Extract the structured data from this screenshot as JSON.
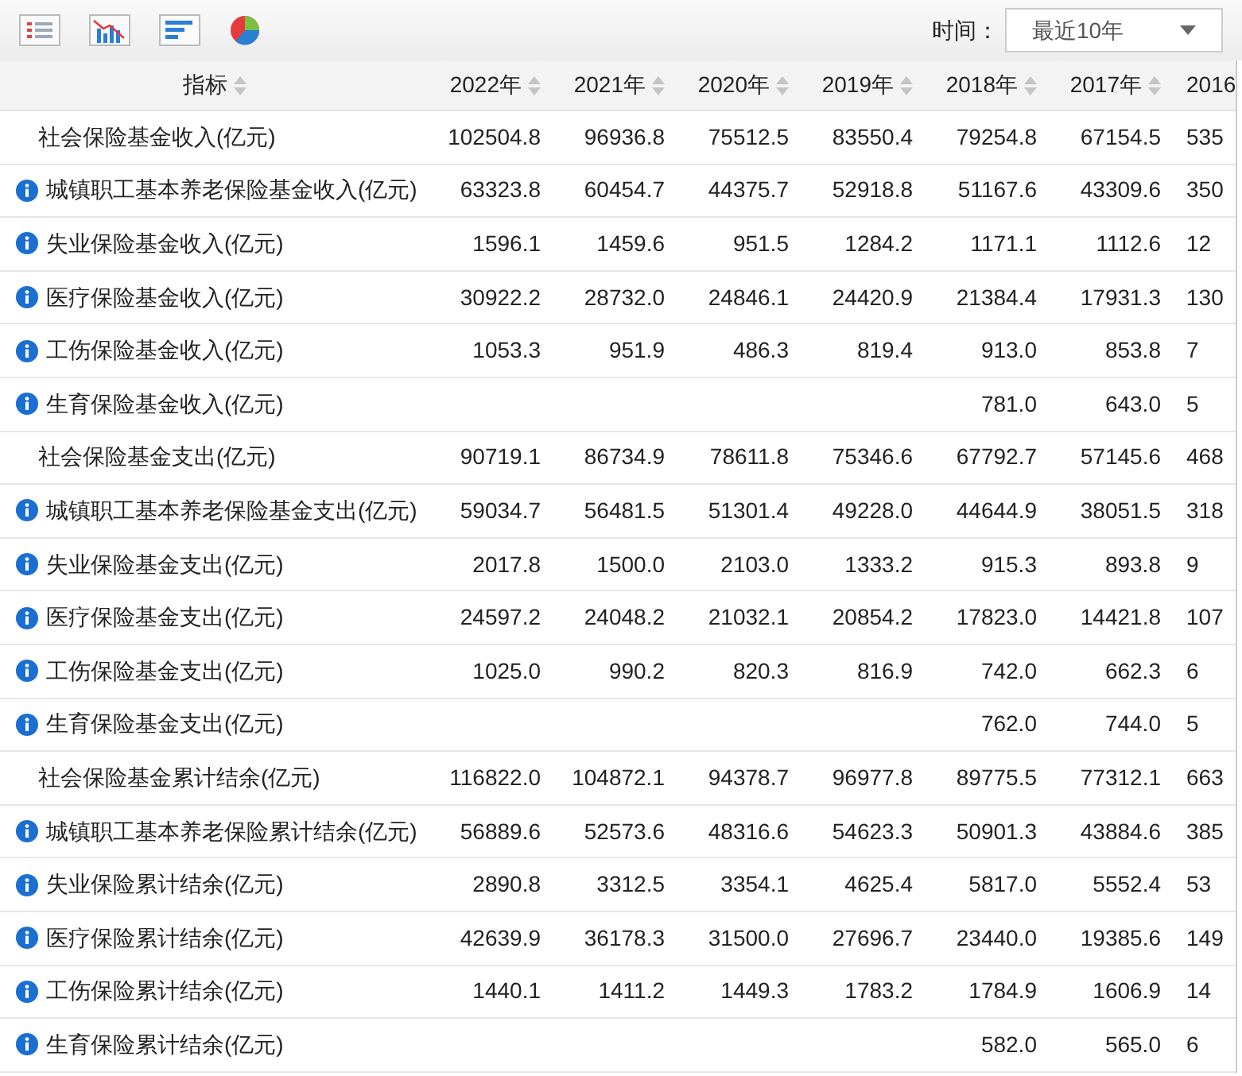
{
  "toolbar": {
    "time_label": "时间：",
    "time_select": {
      "value": "最近10年"
    }
  },
  "table": {
    "columns": [
      {
        "label": "指标",
        "sortable": true
      },
      {
        "label": "2022年",
        "sortable": true
      },
      {
        "label": "2021年",
        "sortable": true
      },
      {
        "label": "2020年",
        "sortable": true
      },
      {
        "label": "2019年",
        "sortable": true
      },
      {
        "label": "2018年",
        "sortable": true
      },
      {
        "label": "2017年",
        "sortable": true
      },
      {
        "label": "2016"
      }
    ],
    "rows": [
      {
        "kind": "total",
        "label": "社会保险基金收入(亿元)",
        "values": {
          "col_1": "102504.8",
          "col_2": "96936.8",
          "col_3": "75512.5",
          "col_4": "83550.4",
          "col_5": "79254.8",
          "col_6": "67154.5",
          "col_7": "535"
        }
      },
      {
        "kind": "item",
        "label": "城镇职工基本养老保险基金收入(亿元)",
        "values": {
          "col_1": "63323.8",
          "col_2": "60454.7",
          "col_3": "44375.7",
          "col_4": "52918.8",
          "col_5": "51167.6",
          "col_6": "43309.6",
          "col_7": "350"
        }
      },
      {
        "kind": "item",
        "label": "失业保险基金收入(亿元)",
        "values": {
          "col_1": "1596.1",
          "col_2": "1459.6",
          "col_3": "951.5",
          "col_4": "1284.2",
          "col_5": "1171.1",
          "col_6": "1112.6",
          "col_7": "12"
        }
      },
      {
        "kind": "item",
        "label": "医疗保险基金收入(亿元)",
        "values": {
          "col_1": "30922.2",
          "col_2": "28732.0",
          "col_3": "24846.1",
          "col_4": "24420.9",
          "col_5": "21384.4",
          "col_6": "17931.3",
          "col_7": "130"
        }
      },
      {
        "kind": "item",
        "label": "工伤保险基金收入(亿元)",
        "values": {
          "col_1": "1053.3",
          "col_2": "951.9",
          "col_3": "486.3",
          "col_4": "819.4",
          "col_5": "913.0",
          "col_6": "853.8",
          "col_7": "7"
        }
      },
      {
        "kind": "item",
        "label": "生育保险基金收入(亿元)",
        "values": {
          "col_5": "781.0",
          "col_6": "643.0",
          "col_7": "5"
        }
      },
      {
        "kind": "total",
        "label": "社会保险基金支出(亿元)",
        "values": {
          "col_1": "90719.1",
          "col_2": "86734.9",
          "col_3": "78611.8",
          "col_4": "75346.6",
          "col_5": "67792.7",
          "col_6": "57145.6",
          "col_7": "468"
        }
      },
      {
        "kind": "item",
        "label": "城镇职工基本养老保险基金支出(亿元)",
        "values": {
          "col_1": "59034.7",
          "col_2": "56481.5",
          "col_3": "51301.4",
          "col_4": "49228.0",
          "col_5": "44644.9",
          "col_6": "38051.5",
          "col_7": "318"
        }
      },
      {
        "kind": "item",
        "label": "失业保险基金支出(亿元)",
        "values": {
          "col_1": "2017.8",
          "col_2": "1500.0",
          "col_3": "2103.0",
          "col_4": "1333.2",
          "col_5": "915.3",
          "col_6": "893.8",
          "col_7": "9"
        }
      },
      {
        "kind": "item",
        "label": "医疗保险基金支出(亿元)",
        "values": {
          "col_1": "24597.2",
          "col_2": "24048.2",
          "col_3": "21032.1",
          "col_4": "20854.2",
          "col_5": "17823.0",
          "col_6": "14421.8",
          "col_7": "107"
        }
      },
      {
        "kind": "item",
        "label": "工伤保险基金支出(亿元)",
        "values": {
          "col_1": "1025.0",
          "col_2": "990.2",
          "col_3": "820.3",
          "col_4": "816.9",
          "col_5": "742.0",
          "col_6": "662.3",
          "col_7": "6"
        }
      },
      {
        "kind": "item",
        "label": "生育保险基金支出(亿元)",
        "values": {
          "col_5": "762.0",
          "col_6": "744.0",
          "col_7": "5"
        }
      },
      {
        "kind": "total",
        "label": "社会保险基金累计结余(亿元)",
        "values": {
          "col_1": "116822.0",
          "col_2": "104872.1",
          "col_3": "94378.7",
          "col_4": "96977.8",
          "col_5": "89775.5",
          "col_6": "77312.1",
          "col_7": "663"
        }
      },
      {
        "kind": "item",
        "label": "城镇职工基本养老保险累计结余(亿元)",
        "values": {
          "col_1": "56889.6",
          "col_2": "52573.6",
          "col_3": "48316.6",
          "col_4": "54623.3",
          "col_5": "50901.3",
          "col_6": "43884.6",
          "col_7": "385"
        }
      },
      {
        "kind": "item",
        "label": "失业保险累计结余(亿元)",
        "values": {
          "col_1": "2890.8",
          "col_2": "3312.5",
          "col_3": "3354.1",
          "col_4": "4625.4",
          "col_5": "5817.0",
          "col_6": "5552.4",
          "col_7": "53"
        }
      },
      {
        "kind": "item",
        "label": "医疗保险累计结余(亿元)",
        "values": {
          "col_1": "42639.9",
          "col_2": "36178.3",
          "col_3": "31500.0",
          "col_4": "27696.7",
          "col_5": "23440.0",
          "col_6": "19385.6",
          "col_7": "149"
        }
      },
      {
        "kind": "item",
        "label": "工伤保险累计结余(亿元)",
        "values": {
          "col_1": "1440.1",
          "col_2": "1411.2",
          "col_3": "1449.3",
          "col_4": "1783.2",
          "col_5": "1784.9",
          "col_6": "1606.9",
          "col_7": "14"
        }
      },
      {
        "kind": "item",
        "label": "生育保险累计结余(亿元)",
        "values": {
          "col_5": "582.0",
          "col_6": "565.0",
          "col_7": "6"
        }
      }
    ]
  }
}
